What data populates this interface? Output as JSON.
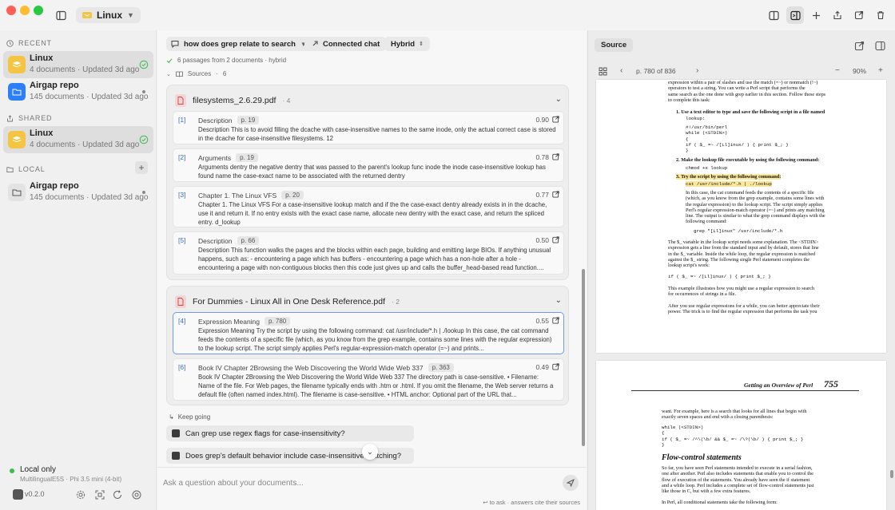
{
  "window": {
    "workspace_name": "Linux"
  },
  "sidebar": {
    "sections": {
      "recent": "RECENT",
      "shared": "SHARED",
      "local": "LOCAL"
    },
    "recent_items": [
      {
        "name": "Linux",
        "meta": "4 documents · Updated 3d ago",
        "status": "synced"
      },
      {
        "name": "Airgap repo",
        "meta": "145 documents · Updated 3d ago",
        "status": "local"
      }
    ],
    "shared_items": [
      {
        "name": "Linux",
        "meta": "4 documents · Updated 3d ago",
        "status": "synced"
      }
    ],
    "local_items": [
      {
        "name": "Airgap repo",
        "meta": "145 documents · Updated 3d ago",
        "status": "local"
      }
    ],
    "local_status": {
      "title": "Local only",
      "subtitle": "MultilingualE5S · Phi 3.5 mini (4-bit)"
    },
    "version": "v0.2.0"
  },
  "chat": {
    "query": "how does grep relate to search",
    "mode_connected": "Connected chat",
    "mode_search": "Hybrid",
    "summary": "6 passages from 2 documents · hybrid",
    "sources_label": "Sources",
    "sources_count": "6",
    "documents": [
      {
        "name": "filesystems_2.6.29.pdf",
        "count": "· 4",
        "passages": [
          {
            "num": "[1]",
            "title": "Description",
            "page": "p. 19",
            "score": "0.90",
            "text": "Description This is to avoid filling the dcache with case-insensitive names to the same inode, only the actual correct case is stored in the dcache for case-insensitive filesystems. 12"
          },
          {
            "num": "[2]",
            "title": "Arguments",
            "page": "p. 19",
            "score": "0.78",
            "text": "Arguments dentry the negative dentry that was passed to the parent's lookup func inode the inode case-insensitive lookup has found name the case-exact name to be associated with the returned dentry"
          },
          {
            "num": "[3]",
            "title": "Chapter 1. The Linux VFS",
            "page": "p. 20",
            "score": "0.77",
            "text": "Chapter 1. The Linux VFS For a case-insensitive lookup match and if the the case-exact dentry already exists in in the dcache, use it and return it. If no entry exists with the exact case name, allocate new dentry with the exact case, and return the spliced entry. d_lookup"
          },
          {
            "num": "[5]",
            "title": "Description",
            "page": "p. 66",
            "score": "0.50",
            "text": "Description This function walks the pages and the blocks within each page, building and emitting large BIOs. If anything unusual happens, such as: - encountering a page which has buffers - encountering a page which has a non-hole after a hole - encountering a page with non-contiguous blocks then this code just gives up and calls the buffer_head-based read function...."
          }
        ]
      },
      {
        "name": "For Dummies - Linux All in One Desk Reference.pdf",
        "count": "· 2",
        "passages": [
          {
            "num": "[4]",
            "title": "Expression Meaning",
            "page": "p. 780",
            "score": "0.55",
            "text": "Expression Meaning Try the script by using the following command: cat /usr/include/*.h | ./lookup In this case, the cat command feeds the contents of a specific file (which, as you know from the grep example, contains some lines with the regular expression) to the lookup script. The script simply applies Perl's regular-expression-match operator (=~) and prints..."
          },
          {
            "num": "[6]",
            "title": "Book IV Chapter 2Browsing the Web Discovering the World Wide Web 337",
            "page": "p. 363",
            "score": "0.49",
            "text": "Book IV Chapter 2Browsing the Web Discovering the World Wide Web 337 The directory path is case-sensitive. • Filename: Name of the file. For Web pages, the filename typically ends with .htm or .html. If you omit the filename, the Web server returns a default file (often named index.html). The filename is case-sensitive. • HTML anchor: Optional part of the URL that..."
          }
        ]
      }
    ],
    "keep_going": "Keep going",
    "suggestions": [
      "Can grep use regex flags for case-insensitivity?",
      "Does grep's default behavior include case-insensitive matching?"
    ],
    "input_placeholder": "Ask a question about your documents...",
    "hint": "↩ to ask · answers cite their sources"
  },
  "preview": {
    "tab": "Source",
    "page_label": "p. 780 of 836",
    "zoom": "90%",
    "page1": {
      "lines_top": [
        "expression within a pair of slashes and use the match (=~) or nonmatch (!~)",
        "operators to test a string. You can write a Perl script that performs the",
        "same search as the one done with grep earlier in this section. Follow these steps",
        "to complete this task:"
      ],
      "step1": "1. Use a text editor to type and save the following script in a file named",
      "step1_name": "lookup:",
      "code1": [
        "#!/usr/bin/perl",
        "while (<STDIN>)",
        "{",
        "    if ( $_ =~ /[Ll]inux/ ) { print $_; }",
        "}"
      ],
      "step2": "2. Make the lookup file executable by using the following command:",
      "code2": "chmod +x lookup",
      "step3": "3. Try the script by using the following command:",
      "code3": "cat /usr/include/*.h | ./lookup",
      "para3": [
        "In this case, the cat command feeds the contents of a specific file",
        "(which, as you know from the grep example, contains some lines with",
        "the regular expression) to the lookup script. The script simply applies",
        "Perl's regular expression-match operator (=~) and prints any matching",
        "line. The output is similar to what the grep command displays with the",
        "following command:"
      ],
      "code4": "grep \"[Ll]inux\" /usr/include/*.h",
      "para4": [
        "The $_ variable in the lookup script needs some explanation. The <STDIN>",
        "expression gets a line from the standard input and by default, stores that line",
        "in the $_ variable. Inside the while loop, the regular expression is matched",
        "against the $_ string. The following single Perl statement completes the",
        "lookup script's work:"
      ],
      "code5": "if ( $_ =~ /[Ll]inux/ ) { print $_; }",
      "para5": [
        "This example illustrates how you might use a regular expression to search",
        "for occurrences of strings in a file."
      ],
      "para6": [
        "After you use regular expressions for a while, you can better appreciate their",
        "power. The trick is to find the regular expression that performs the task you"
      ]
    },
    "page2": {
      "header": "Getting an Overview of Perl",
      "number": "755",
      "intro": [
        "want. For example, here is a search that looks for all lines that begin with",
        "exactly seven spaces and end with a closing parenthesis:"
      ],
      "code": [
        "while (<STDIN>)",
        "{",
        "    if ( $_ =~ /^\\(\\b/ && $_ =~ /\\?(\\b/ ) { print $_; }",
        "}"
      ],
      "heading": "Flow-control statements",
      "para": [
        "So far, you have seen Perl statements intended to execute in a serial fashion,",
        "one after another. Perl also includes statements that enable you to control the",
        "flow of execution of the statements. You already have seen the if statement",
        "and a while loop. Perl includes a complete set of flow-control statements just",
        "like those in C, but with a few extra features."
      ],
      "last": "In Perl, all conditional statements take the following form:"
    }
  },
  "colors": {
    "accent": "#3a6fc8",
    "workspace_yellow": "#f4c542",
    "workspace_blue": "#2d7ff9",
    "highlight": "#fbe69a",
    "status_green": "#3fb950"
  },
  "icons": {
    "sidebar_toggle": "sidebar-toggle-icon",
    "new_chat": "plus-icon",
    "share": "share-icon",
    "external": "external-link-icon",
    "trash": "trash-icon",
    "settings": "gear-icon"
  }
}
